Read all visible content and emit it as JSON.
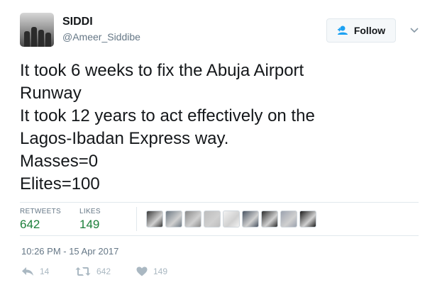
{
  "user": {
    "name": "SIDDI",
    "handle": "@Ameer_Siddibe"
  },
  "follow_label": "Follow",
  "tweet_lines": [
    "It took 6 weeks to fix the Abuja Airport",
    "Runway",
    "It took 12 years to act effectively on the",
    "Lagos-Ibadan Express way.",
    "Masses=0",
    "Elites=100"
  ],
  "stats": {
    "retweets_label": "RETWEETS",
    "retweets_value": "642",
    "likes_label": "LIKES",
    "likes_value": "149"
  },
  "liker_avatar_colors": [
    "#3a3a3a",
    "#6f7a84",
    "#8a8a8a",
    "#bdbdbd",
    "#f2f2f2",
    "#4b5563",
    "#2d2d2d",
    "#9ca3af",
    "#1c1c1c"
  ],
  "timestamp": "10:26 PM - 15 Apr 2017",
  "actions": {
    "reply_count": "14",
    "retweet_count": "642",
    "like_count": "149"
  },
  "colors": {
    "stat_value": "#1b7f3a",
    "secondary_text": "#657786",
    "action_icon": "#aab8c2",
    "border": "#e1e8ed"
  }
}
